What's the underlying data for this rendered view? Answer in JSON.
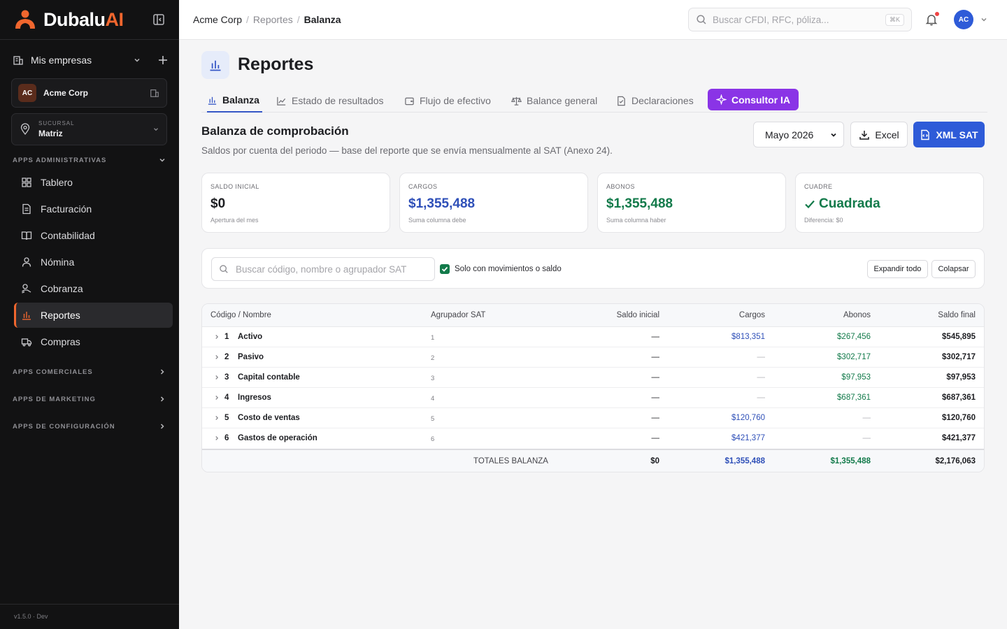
{
  "brand": {
    "name_part1": "Dubalu",
    "name_part2": "AI",
    "accent": "#f0662e"
  },
  "sidebar": {
    "mis_empresas": "Mis empresas",
    "company": {
      "initials": "AC",
      "name": "Acme Corp"
    },
    "branch": {
      "label": "SUCURSAL",
      "value": "Matriz"
    },
    "sections": {
      "admin": "APPS ADMINISTRATIVAS",
      "comerciales": "APPS COMERCIALES",
      "marketing": "APPS DE MARKETING",
      "config": "APPS DE CONFIGURACIÓN"
    },
    "items": [
      {
        "label": "Tablero",
        "icon": "dashboard-icon"
      },
      {
        "label": "Facturación",
        "icon": "invoice-icon"
      },
      {
        "label": "Contabilidad",
        "icon": "book-icon"
      },
      {
        "label": "Nómina",
        "icon": "person-icon"
      },
      {
        "label": "Cobranza",
        "icon": "collect-icon"
      },
      {
        "label": "Reportes",
        "icon": "chart-icon",
        "active": true
      },
      {
        "label": "Compras",
        "icon": "truck-icon"
      }
    ],
    "version": "v1.5.0 · Dev"
  },
  "header": {
    "breadcrumb": [
      "Acme Corp",
      "Reportes",
      "Balanza"
    ],
    "search_placeholder": "Buscar CFDI, RFC, póliza...",
    "shortcut": "⌘K",
    "user_initials": "AC"
  },
  "page": {
    "title": "Reportes",
    "tabs": [
      {
        "label": "Balanza",
        "active": true
      },
      {
        "label": "Estado de resultados"
      },
      {
        "label": "Flujo de efectivo"
      },
      {
        "label": "Balance general"
      },
      {
        "label": "Declaraciones"
      },
      {
        "label": "Consultor IA",
        "highlight": true
      }
    ],
    "section_title": "Balanza de comprobación",
    "section_subtitle": "Saldos por cuenta del periodo — base del reporte que se envía mensualmente al SAT (Anexo 24).",
    "period": "Mayo 2026",
    "excel_label": "Excel",
    "xml_label": "XML SAT"
  },
  "kpis": [
    {
      "label": "SALDO INICIAL",
      "value": "$0",
      "hint": "Apertura del mes",
      "color": "#1c1d21"
    },
    {
      "label": "CARGOS",
      "value": "$1,355,488",
      "hint": "Suma columna debe",
      "color": "#2e4fb8"
    },
    {
      "label": "ABONOS",
      "value": "$1,355,488",
      "hint": "Suma columna haber",
      "color": "#127a4a"
    },
    {
      "label": "CUADRE",
      "value": "Cuadrada",
      "hint": "Diferencia: $0",
      "color": "#127a4a"
    }
  ],
  "filters": {
    "search_placeholder": "Buscar código, nombre o agrupador SAT",
    "checkbox_label": "Solo con movimientos o saldo",
    "checkbox_checked": true,
    "expand_label": "Expandir todo",
    "collapse_label": "Colapsar"
  },
  "table": {
    "headers": {
      "codigo": "Código / Nombre",
      "agrupador": "Agrupador SAT",
      "saldo_inicial": "Saldo inicial",
      "cargos": "Cargos",
      "abonos": "Abonos",
      "saldo_final": "Saldo final"
    },
    "rows": [
      {
        "code": "1",
        "name": "Activo",
        "agrupador": "1",
        "saldo_inicial": "—",
        "cargos": "$813,351",
        "abonos": "$267,456",
        "saldo_final": "$545,895"
      },
      {
        "code": "2",
        "name": "Pasivo",
        "agrupador": "2",
        "saldo_inicial": "—",
        "cargos": "—",
        "abonos": "$302,717",
        "saldo_final": "$302,717"
      },
      {
        "code": "3",
        "name": "Capital contable",
        "agrupador": "3",
        "saldo_inicial": "—",
        "cargos": "—",
        "abonos": "$97,953",
        "saldo_final": "$97,953"
      },
      {
        "code": "4",
        "name": "Ingresos",
        "agrupador": "4",
        "saldo_inicial": "—",
        "cargos": "—",
        "abonos": "$687,361",
        "saldo_final": "$687,361"
      },
      {
        "code": "5",
        "name": "Costo de ventas",
        "agrupador": "5",
        "saldo_inicial": "—",
        "cargos": "$120,760",
        "abonos": "—",
        "saldo_final": "$120,760"
      },
      {
        "code": "6",
        "name": "Gastos de operación",
        "agrupador": "6",
        "saldo_inicial": "—",
        "cargos": "$421,377",
        "abonos": "—",
        "saldo_final": "$421,377"
      }
    ],
    "totals": {
      "label": "TOTALES BALANZA",
      "saldo_inicial": "$0",
      "cargos": "$1,355,488",
      "abonos": "$1,355,488",
      "saldo_final": "$2,176,063"
    }
  }
}
